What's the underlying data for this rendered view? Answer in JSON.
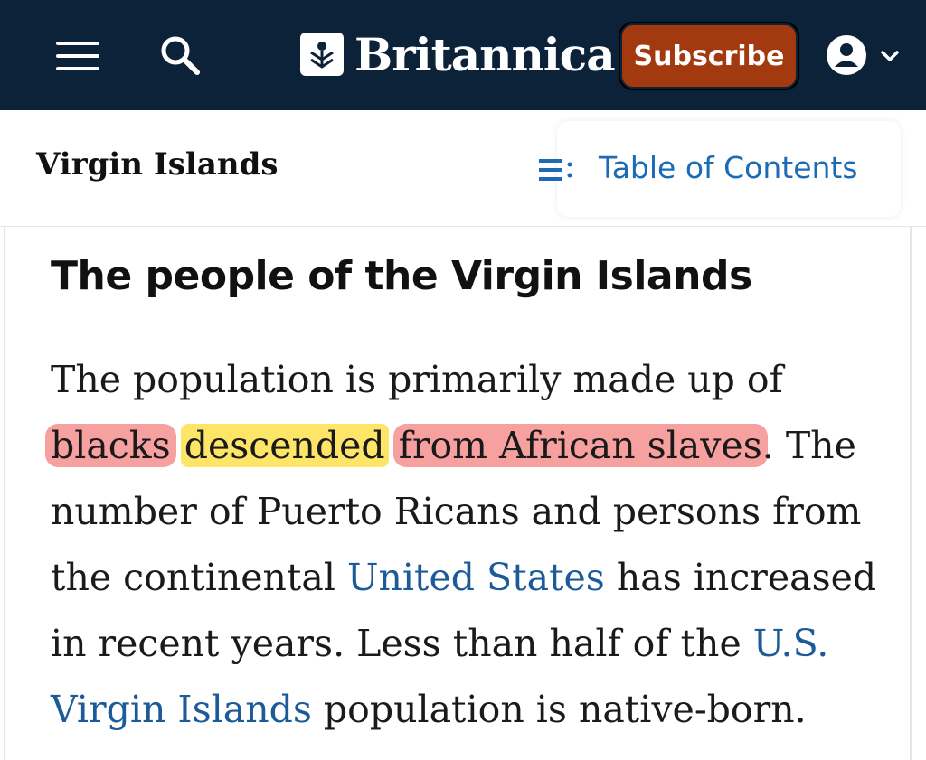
{
  "header": {
    "brand_name": "Britannica",
    "subscribe_label": "Subscribe",
    "colors": {
      "background": "#0b2239",
      "subscribe": "#a33a0f"
    }
  },
  "subnav": {
    "article_title": "Virgin Islands",
    "toc_label": "Table of Contents",
    "toc_color": "#1c6bb5"
  },
  "section": {
    "heading": "The people of the Virgin Islands",
    "paragraph": {
      "l1": "The population is primarily made up of",
      "l2_hl_blacks": "blacks",
      "l2_hl_descended": "descended",
      "l2_hl_rest": "from African slaves",
      "l2_tail": ". The",
      "l3": "number of Puerto Ricans and persons from",
      "l4_pre": "the continental ",
      "l4_link": "United States",
      "l4_post": " has increased",
      "l5_pre": "in recent years. Less than half of the ",
      "l5_link": "U.S.",
      "l6_link": "Virgin Islands",
      "l6_post": " population is native-born."
    },
    "highlight_colors": {
      "pink": "#f7a0a0",
      "yellow": "#fde567"
    }
  },
  "icons": [
    "menu-icon",
    "search-icon",
    "britannica-logo-icon",
    "account-icon",
    "chevron-down-icon",
    "list-icon"
  ]
}
